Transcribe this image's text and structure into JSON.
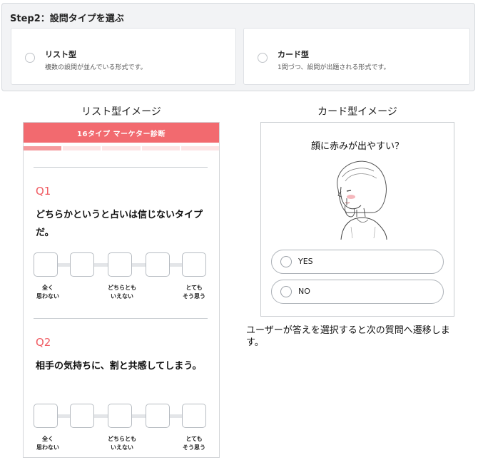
{
  "step": {
    "title": "Step2：設問タイプを選ぶ",
    "options": [
      {
        "label": "リスト型",
        "description": "複数の設問が並んでいる形式です。"
      },
      {
        "label": "カード型",
        "description": "1問づつ、設問が出題される形式です。"
      }
    ]
  },
  "list_preview": {
    "caption": "リスト型イメージ",
    "header": "16タイプ マーケター診断",
    "progress": {
      "segments": 5,
      "filled": 1
    },
    "questions": [
      {
        "number": "Q1",
        "text": "どちらかというと占いは信じないタイプだ。"
      },
      {
        "number": "Q2",
        "text": "相手の気持ちに、割と共感してしまう。"
      }
    ],
    "scale_labels": {
      "left": [
        "全く",
        "思わない"
      ],
      "middle": [
        "どちらとも",
        "いえない"
      ],
      "right": [
        "とても",
        "そう思う"
      ]
    }
  },
  "card_preview": {
    "caption": "カード型イメージ",
    "question": "顔に赤みが出やすい？",
    "answers": [
      "YES",
      "NO"
    ],
    "illustration": "girl-thinking-illustration",
    "note": "ユーザーが答えを選択すると次の質問へ遷移します。"
  },
  "colors": {
    "accent": "#f26a6f",
    "question_number": "#f05b62",
    "progress_filled": "#f59a9d",
    "progress_empty": "#fde4e5"
  }
}
